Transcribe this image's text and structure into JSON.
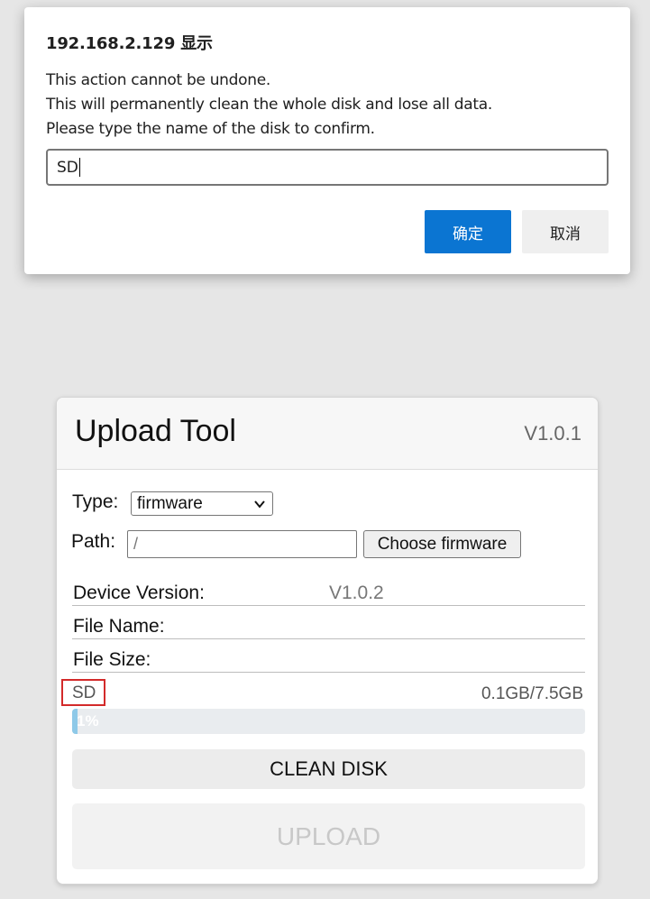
{
  "dialog": {
    "title": "192.168.2.129 显示",
    "messages": [
      "This action cannot be undone.",
      "This will permanently clean the whole disk and lose all data.",
      "Please type the name of the disk to confirm."
    ],
    "input_value": "SD",
    "ok_label": "确定",
    "cancel_label": "取消",
    "ok_color": "#0b75d2"
  },
  "card": {
    "title": "Upload Tool",
    "version": "V1.0.1",
    "type_label": "Type:",
    "type_value": "firmware",
    "path_label": "Path:",
    "path_value": "/",
    "choose_label": "Choose firmware",
    "rows": [
      {
        "label": "Device Version:",
        "value": "V1.0.2"
      },
      {
        "label": "File Name:",
        "value": ""
      },
      {
        "label": "File Size:",
        "value": ""
      }
    ],
    "disk_name": "SD",
    "disk_usage": "0.1GB/7.5GB",
    "progress_text": "1%",
    "progress_percent": 1,
    "clean_label": "CLEAN DISK",
    "upload_label": "UPLOAD",
    "highlight_color": "#d32a2a"
  }
}
